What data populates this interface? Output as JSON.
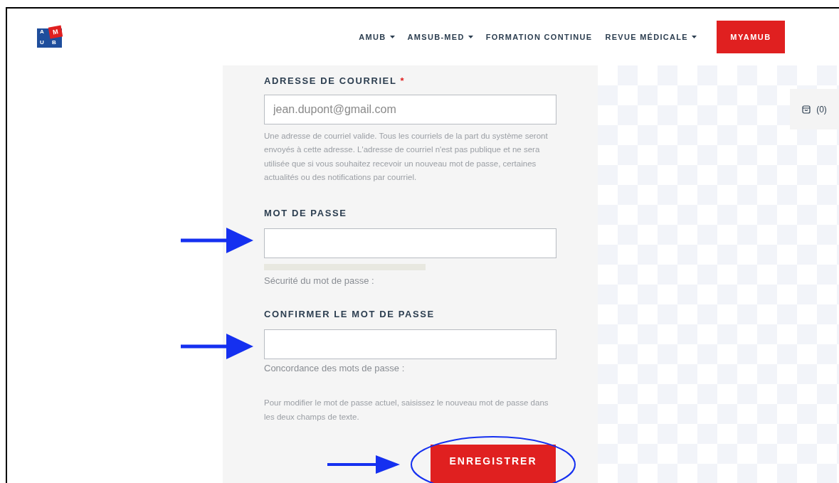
{
  "logo": {
    "letters": [
      "A",
      "M",
      "U",
      "B"
    ]
  },
  "nav": [
    {
      "label": "AMUB",
      "dropdown": true
    },
    {
      "label": "AMSUB-MED",
      "dropdown": true
    },
    {
      "label": "FORMATION CONTINUE",
      "dropdown": false
    },
    {
      "label": "REVUE MÉDICALE",
      "dropdown": true
    }
  ],
  "nav_button": "MYAMUB",
  "cart": {
    "count": "(0)"
  },
  "form": {
    "email": {
      "label": "ADRESSE DE COURRIEL",
      "required_mark": "*",
      "value": "jean.dupont@gmail.com",
      "help": "Une adresse de courriel valide. Tous les courriels de la part du système seront envoyés à cette adresse. L'adresse de courriel n'est pas publique et ne sera utilisée que si vous souhaitez recevoir un nouveau mot de passe, certaines actualités ou des notifications par courriel."
    },
    "password": {
      "label": "MOT DE PASSE",
      "strength": {
        "label": "Sécurité du mot de passe :"
      }
    },
    "confirm": {
      "label": "CONFIRMER LE MOT DE PASSE",
      "match_label": "Concordance des mots de passe :"
    },
    "help": "Pour modifier le mot de passe actuel, saisissez le nouveau mot de passe dans les deux champs de texte.",
    "submit": "ENREGISTRER"
  }
}
